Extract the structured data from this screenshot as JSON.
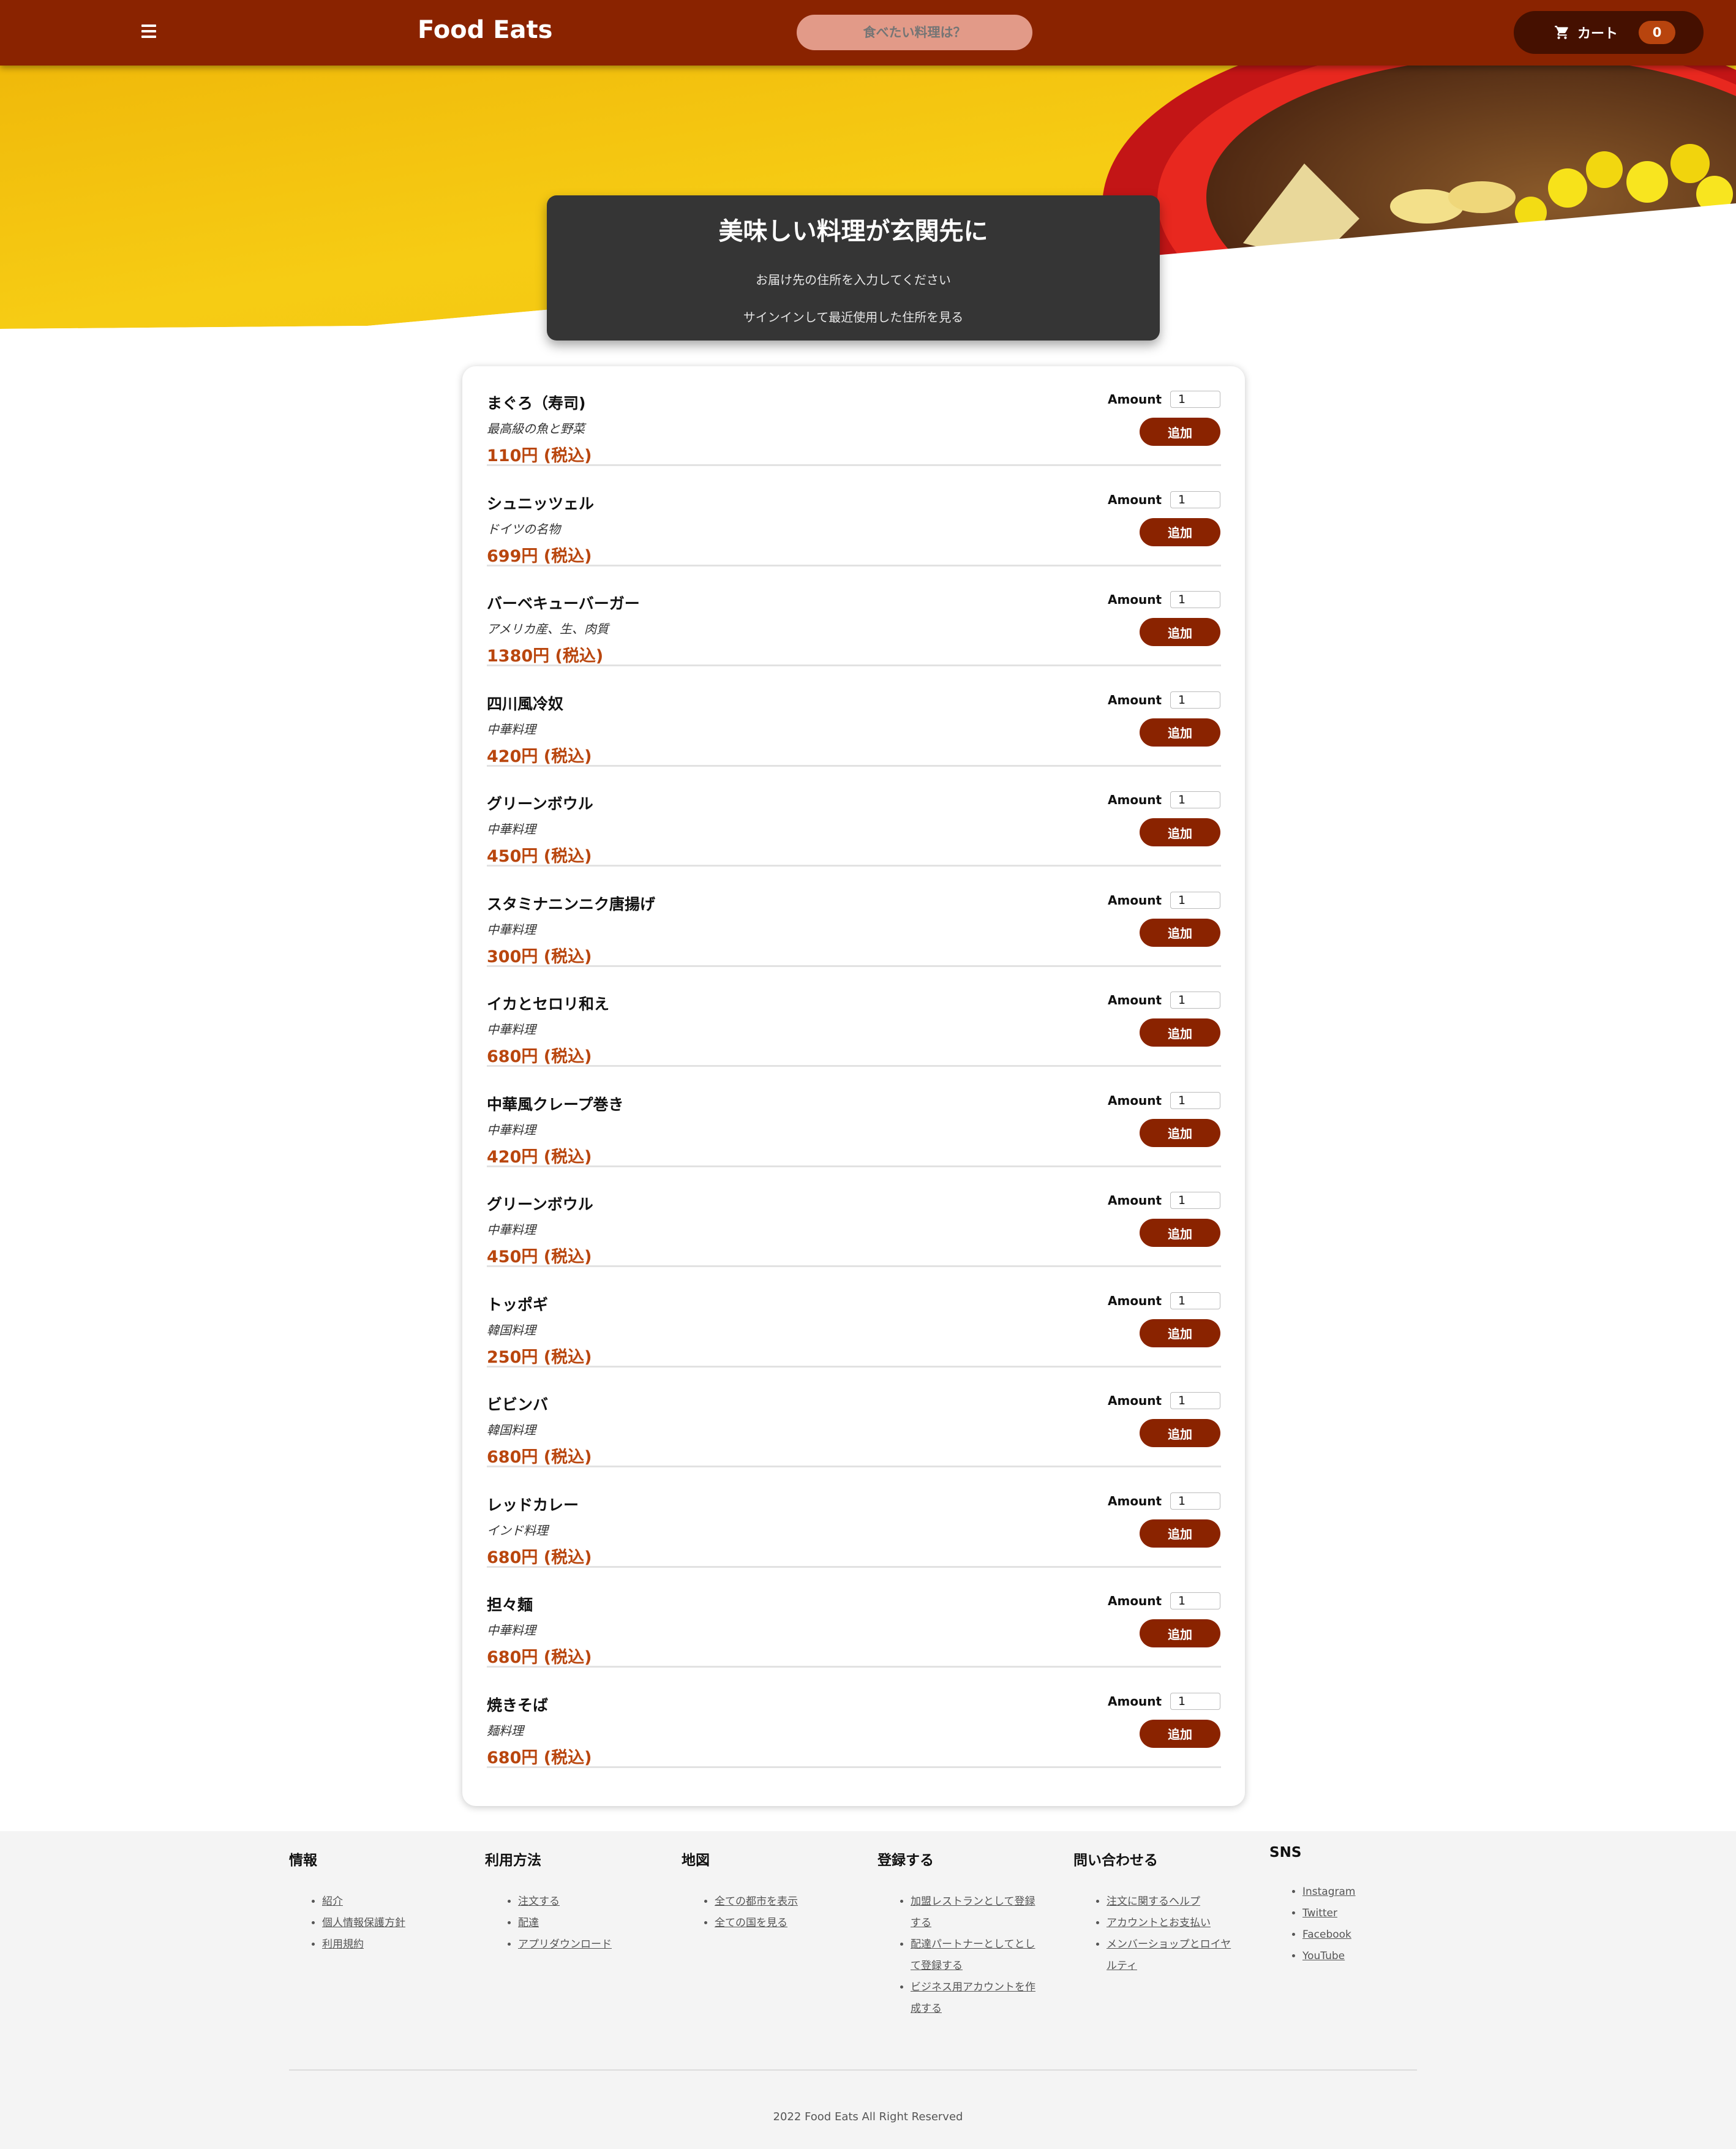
{
  "header": {
    "brand": "Food Eats",
    "search_placeholder": "食べたい料理は？",
    "cart_label": "カート",
    "cart_count": "0"
  },
  "hero": {
    "title": "美味しい料理が玄関先に",
    "line1": "お届け先の住所を入力してください",
    "line2": "サインインして最近使用した住所を見る"
  },
  "menu": {
    "amount_label": "Amount",
    "add_label": "追加",
    "items": [
      {
        "name": "まぐろ（寿司)",
        "desc": "最高級の魚と野菜",
        "price": "110円 (税込)",
        "amount": "1"
      },
      {
        "name": "シュニッツェル",
        "desc": "ドイツの名物",
        "price": "699円 (税込)",
        "amount": "1"
      },
      {
        "name": "バーベキューバーガー",
        "desc": "アメリカ産、生、肉質",
        "price": "1380円 (税込)",
        "amount": "1"
      },
      {
        "name": "四川風冷奴",
        "desc": "中華料理",
        "price": "420円 (税込)",
        "amount": "1"
      },
      {
        "name": "グリーンボウル",
        "desc": "中華料理",
        "price": "450円 (税込)",
        "amount": "1"
      },
      {
        "name": "スタミナニンニク唐揚げ",
        "desc": "中華料理",
        "price": "300円 (税込)",
        "amount": "1"
      },
      {
        "name": "イカとセロリ和え",
        "desc": "中華料理",
        "price": "680円 (税込)",
        "amount": "1"
      },
      {
        "name": "中華風クレープ巻き",
        "desc": "中華料理",
        "price": "420円 (税込)",
        "amount": "1"
      },
      {
        "name": "グリーンボウル",
        "desc": "中華料理",
        "price": "450円 (税込)",
        "amount": "1"
      },
      {
        "name": "トッポギ",
        "desc": "韓国料理",
        "price": "250円 (税込)",
        "amount": "1"
      },
      {
        "name": "ビビンバ",
        "desc": "韓国料理",
        "price": "680円 (税込)",
        "amount": "1"
      },
      {
        "name": "レッドカレー",
        "desc": "インド料理",
        "price": "680円 (税込)",
        "amount": "1"
      },
      {
        "name": "担々麺",
        "desc": "中華料理",
        "price": "680円 (税込)",
        "amount": "1"
      },
      {
        "name": "焼きそば",
        "desc": "麺料理",
        "price": "680円 (税込)",
        "amount": "1"
      }
    ]
  },
  "footer": {
    "columns": [
      {
        "title": "情報",
        "links": [
          "紹介",
          "個人情報保護方針",
          "利用規約"
        ]
      },
      {
        "title": "利用方法",
        "links": [
          "注文する",
          "配達",
          "アプリダウンロード"
        ]
      },
      {
        "title": "地図",
        "links": [
          "全ての都市を表示",
          "全ての国を見る"
        ]
      },
      {
        "title": "登録する",
        "links": [
          "加盟レストランとして登録する",
          "配達パートナーとしてとして登録する",
          "ビジネス用アカウントを作成する"
        ]
      },
      {
        "title": "問い合わせる",
        "links": [
          "注文に関するヘルプ",
          "アカウントとお支払い",
          "メンバーショップとロイヤルティ"
        ]
      },
      {
        "title": "SNS",
        "links": [
          "Instagram",
          "Twitter",
          "Facebook",
          "YouTube"
        ]
      }
    ],
    "copyright": "2022 Food Eats All Right Reserved"
  },
  "colors": {
    "header": "#8a2300",
    "accent_price": "#b9460e",
    "hero_yellow": "#f3c20c",
    "card_dark": "#353535"
  },
  "icons": [
    "menu-icon",
    "cart-icon"
  ]
}
